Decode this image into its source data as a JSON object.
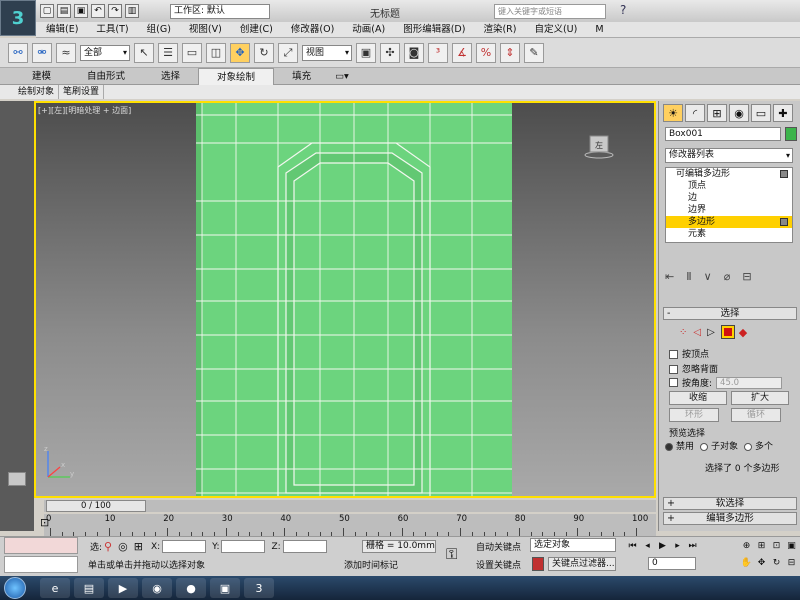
{
  "titlebar": {
    "workspace": "工作区: 默认",
    "window_title": "无标题",
    "search_placeholder": "键入关键字或短语",
    "help_icon": "?"
  },
  "menus": [
    "编辑(E)",
    "工具(T)",
    "组(G)",
    "视图(V)",
    "创建(C)",
    "修改器(O)",
    "动画(A)",
    "图形编辑器(D)",
    "渲染(R)",
    "自定义(U)",
    "M"
  ],
  "toolbar": {
    "filter_dropdown": "全部",
    "refcoord_dropdown": "视图"
  },
  "ribbon": {
    "tabs": [
      "建模",
      "自由形式",
      "选择",
      "对象绘制",
      "填充"
    ],
    "active_tab": "对象绘制",
    "subtabs": [
      "绘制对象",
      "笔刷设置"
    ]
  },
  "viewport": {
    "label": "[+][左][明暗处理 + 边面]",
    "viewcube_label": "左",
    "axis_labels": {
      "z": "z",
      "y": "y",
      "x": "x"
    },
    "mesh_color": "#6cd47e",
    "wire_color": "#f2f7ef",
    "border_color": "#ffe000"
  },
  "command_panel": {
    "tab_icons": [
      "sun-icon",
      "curve-icon",
      "hierarchy-icon",
      "motion-icon",
      "display-icon",
      "utility-icon"
    ],
    "object_name": "Box001",
    "object_color": "#3cb44b",
    "modifier_list": "修改器列表",
    "stack": [
      {
        "label": "可编辑多边形",
        "level": 0,
        "selected": false
      },
      {
        "label": "顶点",
        "level": 1,
        "selected": false
      },
      {
        "label": "边",
        "level": 1,
        "selected": false
      },
      {
        "label": "边界",
        "level": 1,
        "selected": false
      },
      {
        "label": "多边形",
        "level": 1,
        "selected": true
      },
      {
        "label": "元素",
        "level": 1,
        "selected": false
      }
    ],
    "selection_rollout": {
      "title": "选择",
      "by_vertex": "按顶点",
      "ignore_backfacing": "忽略背面",
      "by_angle": "按角度:",
      "angle_value": "45.0",
      "shrink": "收缩",
      "grow": "扩大",
      "ring": "环形",
      "loop": "循环",
      "preview_title": "预览选择",
      "preview_off": "禁用",
      "preview_subobj": "子对象",
      "preview_multi": "多个",
      "status": "选择了 0 个多边形"
    },
    "soft_selection": "软选择",
    "edit_polygons": "编辑多边形"
  },
  "timeline": {
    "slider_text": "0 / 100",
    "ticks": [
      0,
      10,
      20,
      30,
      40,
      50,
      60,
      70,
      80,
      90,
      100
    ]
  },
  "status": {
    "selected_label": "选:",
    "x_label": "X:",
    "y_label": "Y:",
    "z_label": "Z:",
    "grid": "栅格 = 10.0mm",
    "prompt": "单击或单击并拖动以选择对象",
    "add_time_tag": "添加时间标记",
    "auto_key": "自动关键点",
    "set_key": "设置关键点",
    "selection_set": "选定对象",
    "key_filters": "关键点过滤器...",
    "frame": "0"
  }
}
